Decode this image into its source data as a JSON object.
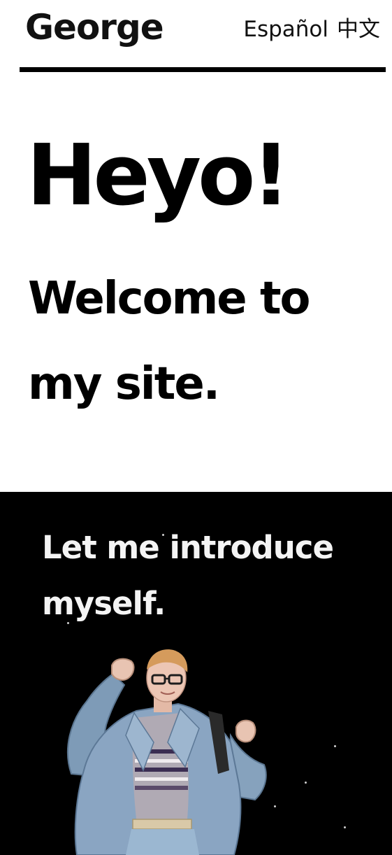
{
  "header": {
    "site_name": "George",
    "languages": [
      {
        "label": "Español"
      },
      {
        "label": "中文"
      }
    ]
  },
  "hero": {
    "heading": "Heyo!",
    "subheading": "Welcome to my site."
  },
  "intro": {
    "heading": "Let me introduce myself."
  },
  "colors": {
    "text": "#000000",
    "background": "#ffffff",
    "section_dark": "#000000",
    "heading_light": "#f4f4f4"
  }
}
